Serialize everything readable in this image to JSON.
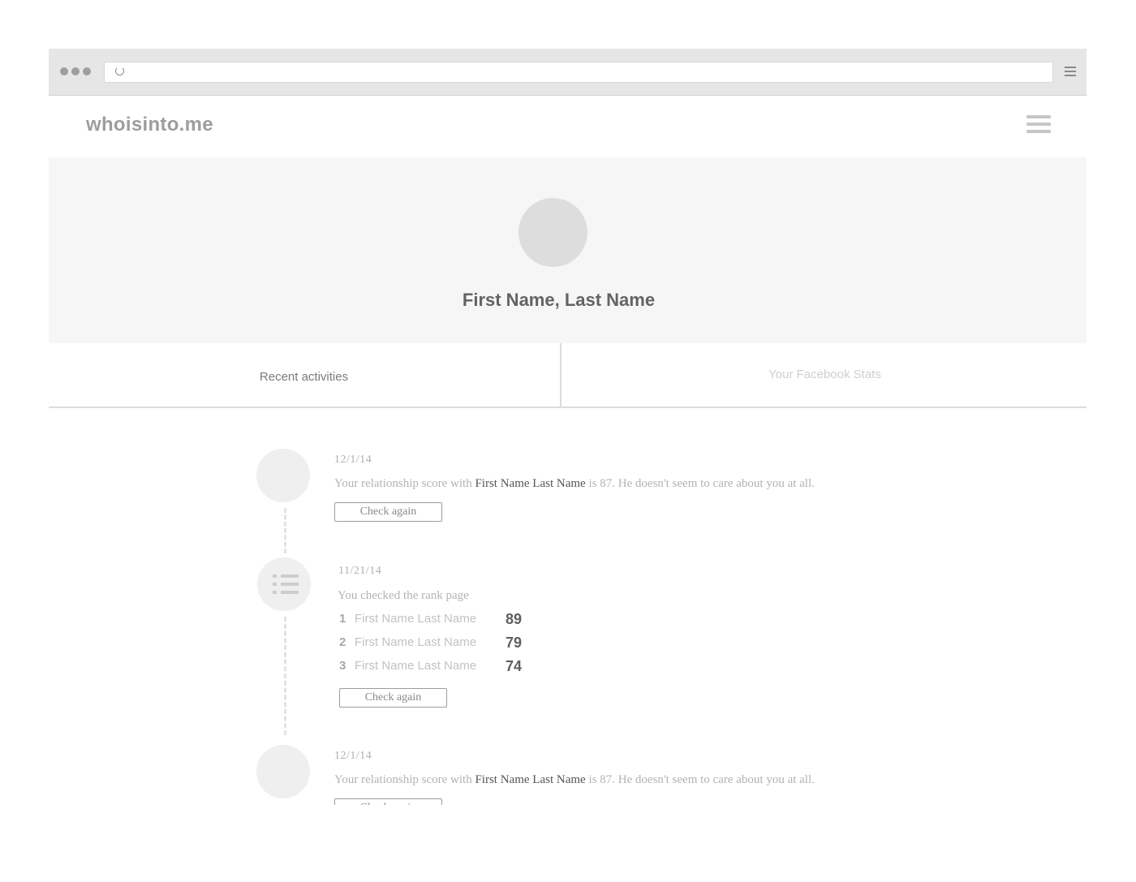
{
  "site": {
    "logo": "whoisinto.me"
  },
  "profile": {
    "name": "First Name, Last Name"
  },
  "tabs": [
    {
      "label": "Recent activities",
      "active": true
    },
    {
      "label": "Your Facebook Stats",
      "active": false
    }
  ],
  "activities": [
    {
      "date": "12/1/14",
      "text_before": "Your relationship score with",
      "person": "First Name Last Name",
      "text_after": "is 87. He doesn't seem to care about you at all.",
      "button": "Check again"
    },
    {
      "date": "11/21/14",
      "text": "You checked the rank page",
      "icon": "list-icon",
      "ranks": [
        {
          "rank": "1",
          "name": "First Name Last Name",
          "score": "89"
        },
        {
          "rank": "2",
          "name": "First Name Last Name",
          "score": "79"
        },
        {
          "rank": "3",
          "name": "First Name Last Name",
          "score": "74"
        }
      ],
      "button": "Check again"
    },
    {
      "date": "12/1/14",
      "text_before": "Your relationship score with",
      "person": "First Name Last Name",
      "text_after": "is 87. He doesn't seem to care about you at all.",
      "button": "Check again"
    }
  ],
  "colors": {
    "accent": "#636363",
    "hero_bg": "#f6f6f6",
    "chrome_bg": "#e6e6e6"
  },
  "icons": {
    "reload": "reload-icon",
    "browser_menu": "hamburger-icon",
    "site_menu": "hamburger-menu-icon"
  }
}
